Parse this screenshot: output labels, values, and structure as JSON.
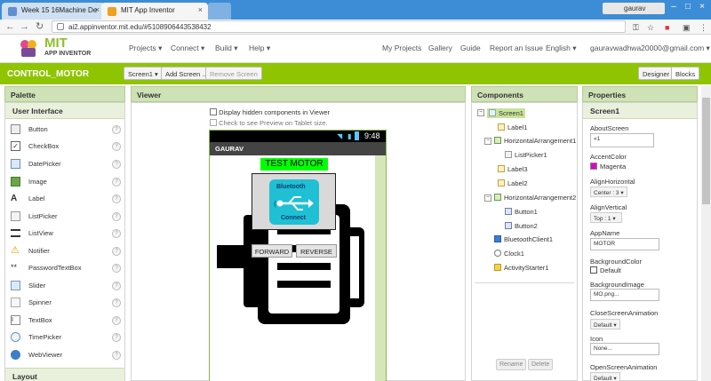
{
  "browser": {
    "tabs": [
      {
        "title": "Week 15 16Machine De"
      },
      {
        "title": "MIT App Inventor"
      }
    ],
    "user": "gaurav",
    "url": "ai2.appinventor.mit.edu/#5108906443538432"
  },
  "header": {
    "logo_title": "MIT",
    "logo_subtitle": "APP INVENTOR",
    "menus": [
      "Projects ▾",
      "Connect ▾",
      "Build ▾",
      "Help ▾"
    ],
    "links": [
      "My Projects",
      "Gallery",
      "Guide",
      "Report an Issue",
      "English ▾",
      "gauravwadhwa20000@gmail.com ▾"
    ]
  },
  "toolbar": {
    "project_name": "CONTROL_MOTOR",
    "screen_select": "Screen1 ▾",
    "add_screen": "Add Screen ...",
    "remove_screen": "Remove Screen",
    "designer": "Designer",
    "blocks": "Blocks"
  },
  "palette": {
    "title": "Palette",
    "section": "User Interface",
    "items": [
      "Button",
      "CheckBox",
      "DatePicker",
      "Image",
      "Label",
      "ListPicker",
      "ListView",
      "Notifier",
      "PasswordTextBox",
      "Slider",
      "Spinner",
      "TextBox",
      "TimePicker",
      "WebViewer"
    ],
    "next_section": "Layout"
  },
  "viewer": {
    "title": "Viewer",
    "hidden_components": "Display hidden components in Viewer",
    "tablet_preview": "Check to see Preview on Tablet size.",
    "time": "9:48",
    "screen_title": "GAURAV",
    "label_title": "TEST MOTOR",
    "bt_top": "Bluetooth",
    "bt_bottom": "Connect",
    "forward": "FORWARD",
    "reverse": "REVERSE"
  },
  "components": {
    "title": "Components",
    "tree": [
      "Screen1",
      "Label1",
      "HorizontalArrangement1",
      "ListPicker1",
      "Label3",
      "Label2",
      "HorizontalArrangement2",
      "Button1",
      "Button2",
      "BluetoothClient1",
      "Clock1",
      "ActivityStarter1"
    ],
    "rename": "Rename",
    "delete": "Delete"
  },
  "properties": {
    "title": "Properties",
    "component": "Screen1",
    "about_label": "AboutScreen",
    "about_value": "«1",
    "accent_label": "AccentColor",
    "accent_value": "Magenta",
    "alignh_label": "AlignHorizontal",
    "alignh_value": "Center : 3 ▾",
    "alignv_label": "AlignVertical",
    "alignv_value": "Top : 1 ▾",
    "appname_label": "AppName",
    "appname_value": "MOTOR",
    "bgcolor_label": "BackgroundColor",
    "bgcolor_value": "Default",
    "bgimage_label": "BackgroundImage",
    "bgimage_value": "MO.png...",
    "closeanim_label": "CloseScreenAnimation",
    "closeanim_value": "Default ▾",
    "icon_label": "Icon",
    "icon_value": "None...",
    "openanim_label": "OpenScreenAnimation",
    "openanim_value": "Default ▾"
  },
  "colors": {
    "accent_green": "#8fc400",
    "label_green": "#00ff00",
    "magenta": "#e000c8",
    "bt_teal": "#1fc0d4"
  }
}
